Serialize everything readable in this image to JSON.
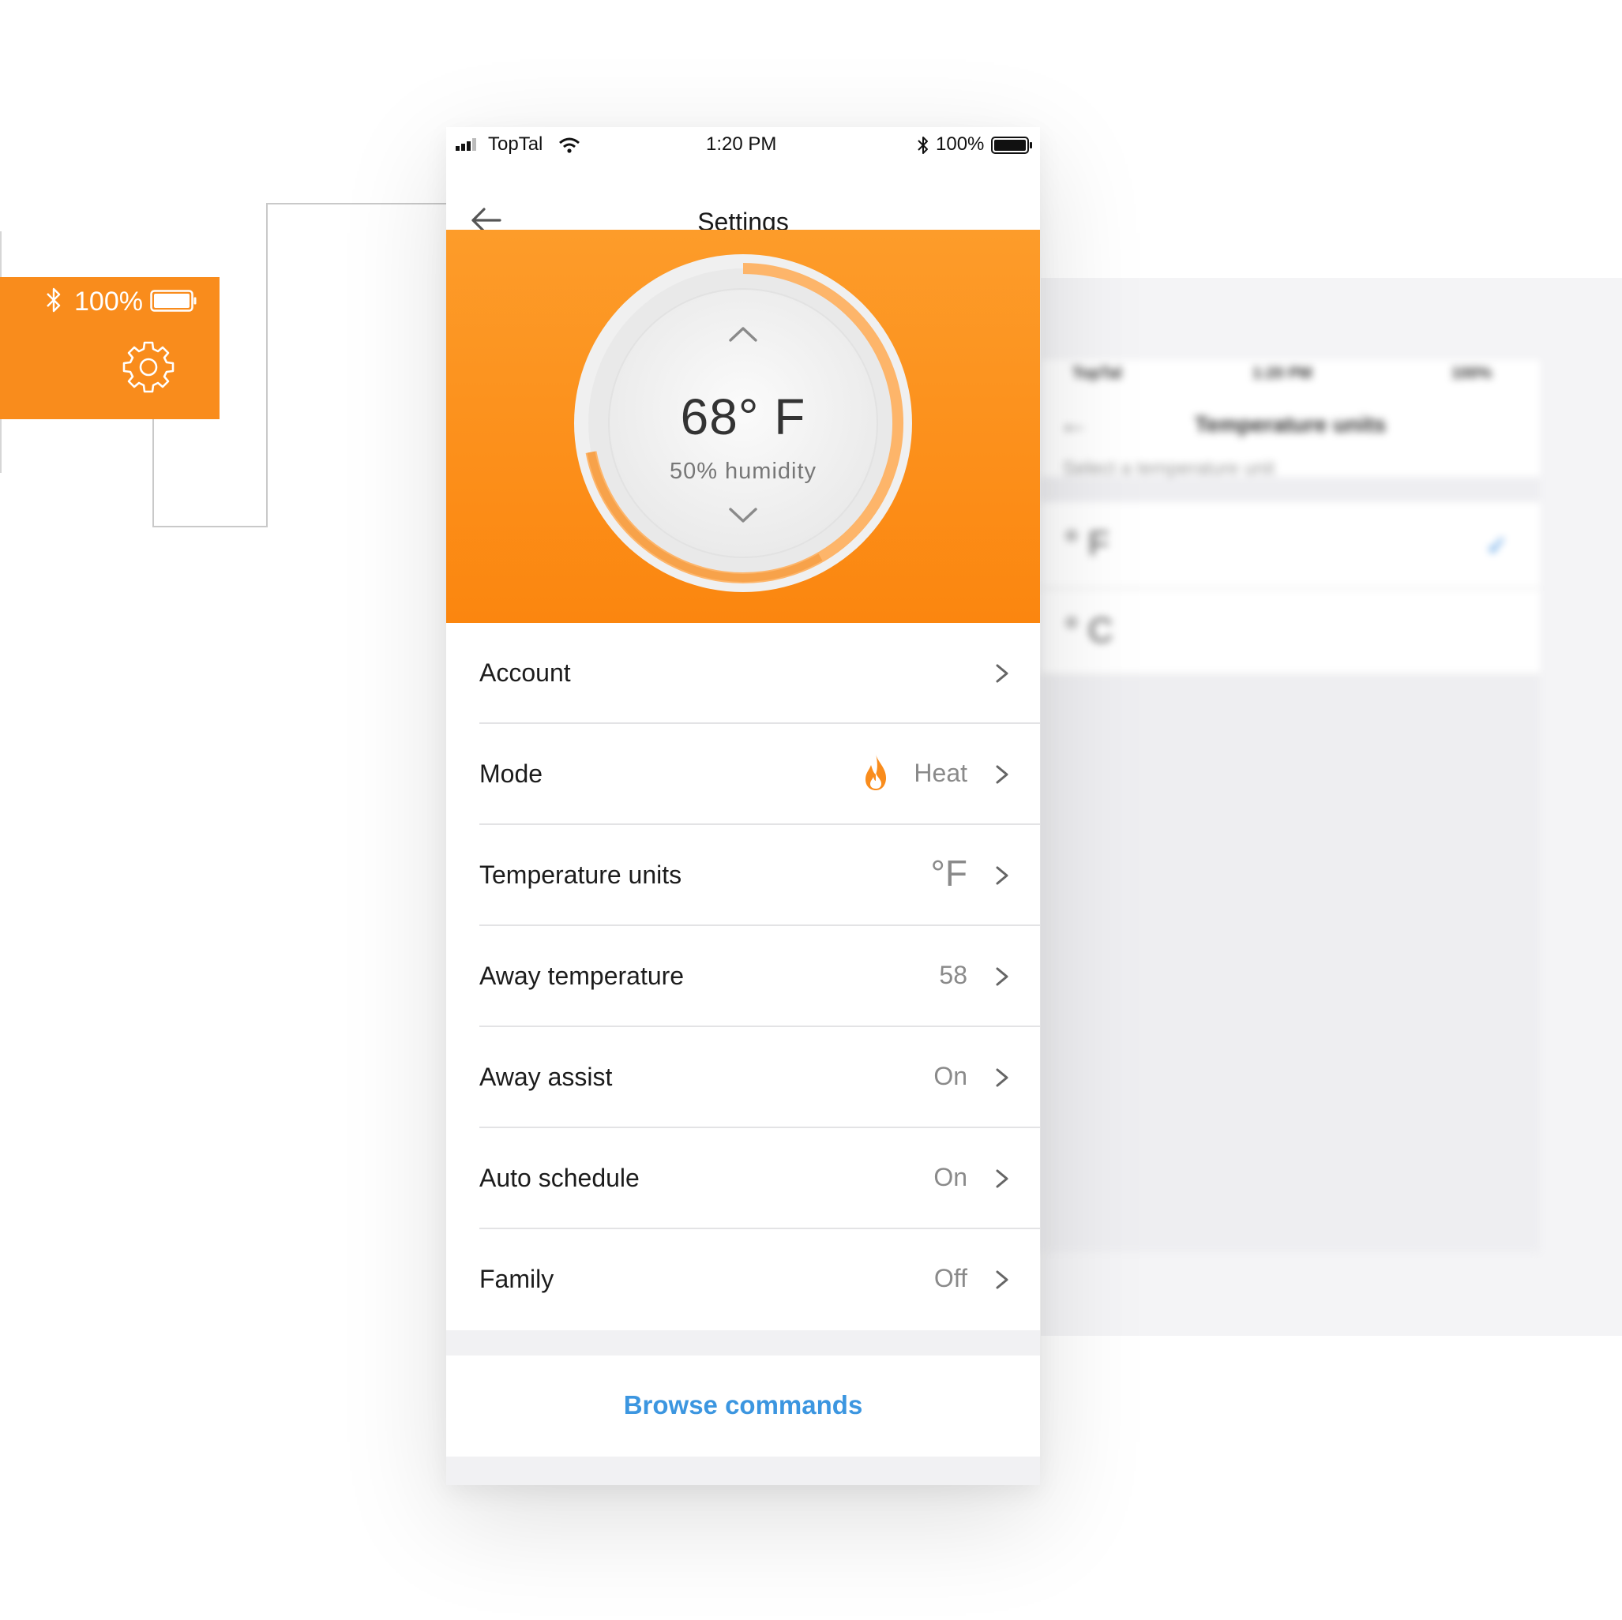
{
  "colors": {
    "accent_orange": "#f98c1c",
    "link_blue": "#3c96e0",
    "text_primary": "#1c1c1c",
    "text_secondary": "#8a8a8a"
  },
  "callout": {
    "battery_text": "100%",
    "icons": [
      "bluetooth-icon",
      "battery-icon",
      "gear-icon"
    ]
  },
  "status_bar": {
    "carrier": "TopTal",
    "time": "1:20 PM",
    "battery": "100%"
  },
  "nav": {
    "title": "Settings",
    "back_icon": "arrow-left-icon"
  },
  "thermostat": {
    "temperature": "68° F",
    "humidity": "50% humidity",
    "ring_progress": 0.72
  },
  "settings": [
    {
      "label": "Account",
      "value": ""
    },
    {
      "label": "Mode",
      "value": "Heat",
      "icon": "flame-icon"
    },
    {
      "label": "Temperature units",
      "value": "°F"
    },
    {
      "label": "Away temperature",
      "value": "58"
    },
    {
      "label": "Away assist",
      "value": "On"
    },
    {
      "label": "Auto schedule",
      "value": "On"
    },
    {
      "label": "Family",
      "value": "Off"
    }
  ],
  "commands": {
    "label": "Browse commands"
  },
  "background_screen": {
    "carrier": "TopTal",
    "time": "1:20 PM",
    "battery": "100%",
    "title": "Temperature units",
    "subtitle": "Select a temperature unit",
    "options": [
      "° F",
      "° C"
    ],
    "selected": "° F"
  }
}
